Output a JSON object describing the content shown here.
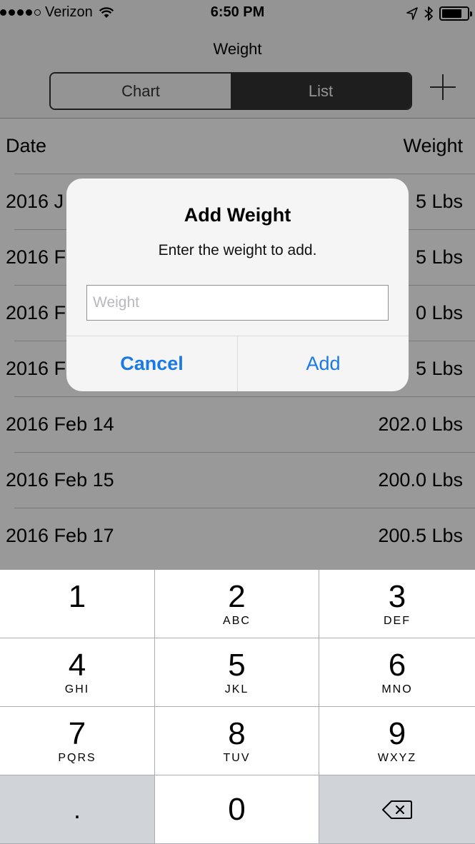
{
  "status_bar": {
    "carrier": "Verizon",
    "time": "6:50 PM",
    "battery_level": 0.8
  },
  "nav": {
    "title": "Weight",
    "segments": [
      {
        "label": "Chart",
        "selected": false
      },
      {
        "label": "List",
        "selected": true
      }
    ],
    "add_icon": "plus-icon"
  },
  "table": {
    "header": {
      "date": "Date",
      "weight": "Weight"
    },
    "rows": [
      {
        "date": "2016 J",
        "weight": "5 Lbs"
      },
      {
        "date": "2016 F",
        "weight": "5 Lbs"
      },
      {
        "date": "2016 F",
        "weight": "0 Lbs"
      },
      {
        "date": "2016 F",
        "weight": "5 Lbs"
      },
      {
        "date": "2016 Feb 14",
        "weight": "202.0 Lbs"
      },
      {
        "date": "2016 Feb 15",
        "weight": "200.0 Lbs"
      },
      {
        "date": "2016 Feb 17",
        "weight": "200.5 Lbs"
      }
    ]
  },
  "alert": {
    "title": "Add Weight",
    "message": "Enter the weight to add.",
    "input_placeholder": "Weight",
    "input_value": "",
    "cancel_label": "Cancel",
    "add_label": "Add"
  },
  "keypad": {
    "keys": [
      {
        "number": "1",
        "letters": ""
      },
      {
        "number": "2",
        "letters": "ABC"
      },
      {
        "number": "3",
        "letters": "DEF"
      },
      {
        "number": "4",
        "letters": "GHI"
      },
      {
        "number": "5",
        "letters": "JKL"
      },
      {
        "number": "6",
        "letters": "MNO"
      },
      {
        "number": "7",
        "letters": "PQRS"
      },
      {
        "number": "8",
        "letters": "TUV"
      },
      {
        "number": "9",
        "letters": "WXYZ"
      },
      {
        "number": ".",
        "letters": ""
      },
      {
        "number": "0",
        "letters": ""
      },
      {
        "number": "",
        "letters": "",
        "icon": "backspace-icon"
      }
    ]
  },
  "colors": {
    "accent": "#1a7ae5",
    "segment_selected": "#333333",
    "keypad_dark": "#d0d3d8"
  }
}
